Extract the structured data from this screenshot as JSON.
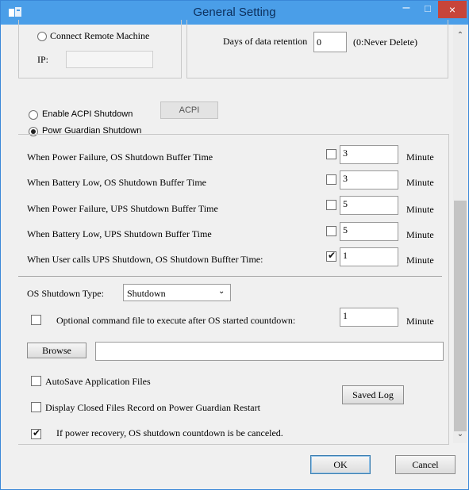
{
  "window": {
    "title": "General Setting",
    "minimize": "–",
    "maximize": "☐",
    "close": "×"
  },
  "remote": {
    "connect_label": "Connect Remote Machine",
    "ip_label": "IP:",
    "ip_value": ""
  },
  "retention": {
    "label": "Days of data retention",
    "value": "0",
    "hint": "(0:Never Delete)"
  },
  "shutdown_mode": {
    "acpi_label": "Enable ACPI Shutdown",
    "acpi_button": "ACPI",
    "powr_label": "Powr Guardian Shutdown",
    "selected": "powr"
  },
  "buffer_rows": [
    {
      "label": "When Power Failure, OS Shutdown Buffer Time",
      "checked": false,
      "value": "3",
      "unit": "Minute"
    },
    {
      "label": "When Battery Low, OS Shutdown Buffer Time",
      "checked": false,
      "value": "3",
      "unit": "Minute"
    },
    {
      "label": "When Power Failure, UPS Shutdown Buffer Time",
      "checked": false,
      "value": "5",
      "unit": "Minute"
    },
    {
      "label": "When Battery Low, UPS Shutdown Buffer Time",
      "checked": false,
      "value": "5",
      "unit": "Minute"
    },
    {
      "label": "When User calls UPS Shutdown, OS Shutdown Buffter Time:",
      "checked": true,
      "value": "1",
      "unit": "Minute"
    }
  ],
  "os_type": {
    "label": "OS Shutdown Type:",
    "selected": "Shutdown"
  },
  "command": {
    "label": "Optional command file to execute after OS started countdown:",
    "checked": false,
    "value": "1",
    "unit": "Minute",
    "browse": "Browse",
    "path": ""
  },
  "options": {
    "autosave": {
      "label": "AutoSave Application Files",
      "checked": false
    },
    "display_closed": {
      "label": "Display Closed Files Record on Power Guardian Restart",
      "checked": false
    },
    "recovery": {
      "label": "If power recovery, OS shutdown countdown is be canceled.",
      "checked": true
    },
    "saved_log": "Saved Log"
  },
  "footer": {
    "ok": "OK",
    "cancel": "Cancel"
  }
}
